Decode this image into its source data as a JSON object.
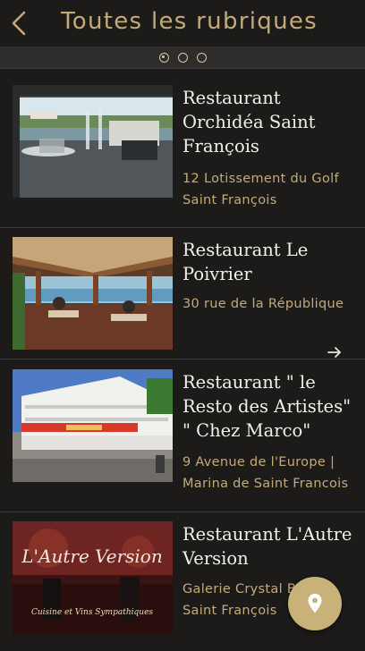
{
  "header": {
    "title": "Toutes les rubriques",
    "back_icon": "chevron-left-icon"
  },
  "pager": {
    "pages": 3,
    "active_index": 0
  },
  "colors": {
    "accent": "#c3ab78",
    "background": "#1c1b1a",
    "fab": "#c9b17a",
    "text": "#f3f1ec"
  },
  "restaurants": [
    {
      "name_lines": [
        "Restaurant",
        "Orchidéa Saint",
        "François"
      ],
      "address_lines": [
        "12 Lotissement du Golf",
        "Saint François"
      ]
    },
    {
      "name_lines": [
        "Restaurant Le",
        "Poivrier"
      ],
      "address_lines": [
        "30 rue de la République"
      ]
    },
    {
      "name_lines": [
        "Restaurant \" le",
        "Resto des Artistes\"",
        "\" Chez Marco\""
      ],
      "address_lines": [
        "9 Avenue de l'Europe |",
        "Marina de Saint Francois"
      ]
    },
    {
      "name_lines": [
        "Restaurant L'Autre",
        "Version"
      ],
      "address_lines": [
        "Galerie Crystal B",
        "Saint François"
      ]
    }
  ],
  "thumbnail_text": {
    "autre_version_logo": "L'Autre Version",
    "autre_version_tagline": "Cuisine et Vins Sympathiques"
  },
  "next_icon": "arrow-right-icon",
  "fab_icon": "map-pin-icon"
}
